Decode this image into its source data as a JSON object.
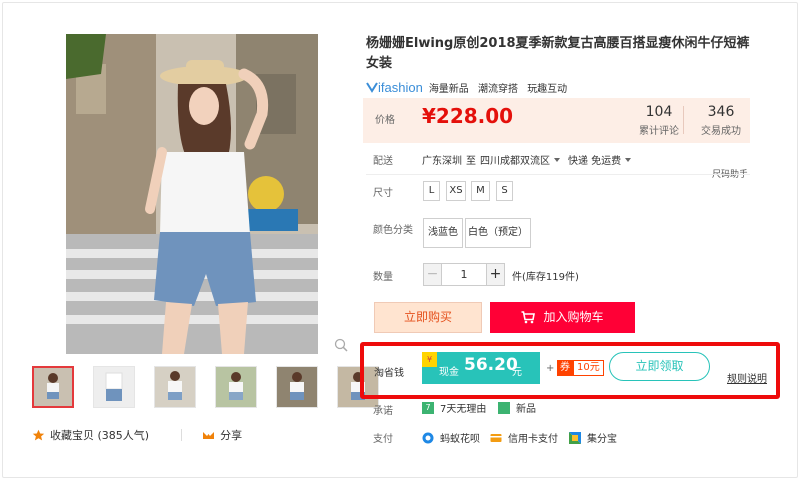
{
  "product": {
    "title": "杨姗姗Elwing原创2018夏季新款复古高腰百搭显瘦休闲牛仔短裤女装",
    "brand": {
      "logo_text": "ifashion",
      "tags": [
        "海量新品",
        "潮流穿搭",
        "玩趣互动"
      ]
    },
    "price": {
      "label": "价格",
      "value": "¥228.00"
    },
    "stats": [
      {
        "num": "104",
        "label": "累计评论"
      },
      {
        "num": "346",
        "label": "交易成功"
      }
    ],
    "shipping": {
      "label": "配送",
      "from": "广东深圳",
      "to_word": "至",
      "to": "四川成都双流区",
      "method": "快递 免运费"
    },
    "size_helper": "尺码助手",
    "size": {
      "label": "尺寸",
      "options": [
        "L",
        "XS",
        "M",
        "S"
      ]
    },
    "color": {
      "label": "颜色分类",
      "options": [
        "浅蓝色",
        "白色（预定）"
      ]
    },
    "quantity": {
      "label": "数量",
      "minus": "−",
      "value": "1",
      "plus": "+",
      "stock": "件(库存119件)"
    },
    "buttons": {
      "buy_now": "立即购买",
      "add_to_cart": "加入购物车"
    },
    "taoshengqian": {
      "label": "淘省钱",
      "cash_label": "现金",
      "cash_amount": "56.20",
      "cash_unit": "元",
      "plus": "+",
      "coupon_tag": "券",
      "coupon_value": "10元",
      "claim_button": "立即领取",
      "rules_link": "规则说明"
    },
    "promise": {
      "label": "承诺",
      "items": [
        "7天无理由",
        "新品"
      ]
    },
    "payment": {
      "label": "支付",
      "items": [
        "蚂蚁花呗",
        "信用卡支付",
        "集分宝"
      ]
    },
    "favorite": {
      "label": "收藏宝贝",
      "count": "(385人气)"
    },
    "share_label": "分享"
  },
  "colors": {
    "price_red": "#e4100b",
    "cart_red": "#ff0036",
    "teal": "#28c3b9",
    "highlight_border": "#ee0b0b",
    "price_bg": "#fdeee6"
  }
}
